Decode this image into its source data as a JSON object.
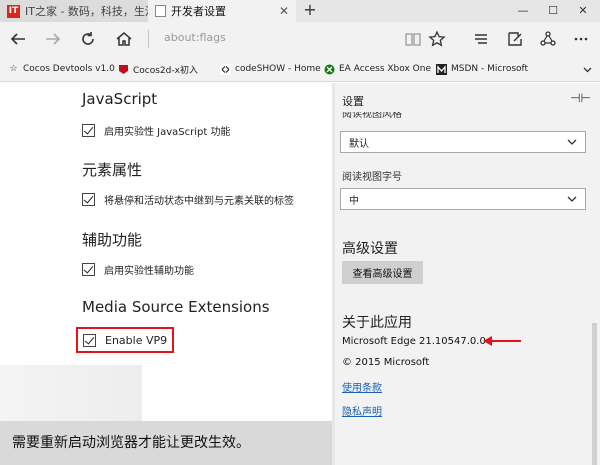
{
  "tabs": [
    {
      "title": "IT之家 - 数码，科技，生活",
      "favicon": "ithome-icon"
    },
    {
      "title": "开发者设置",
      "favicon": "page-icon"
    }
  ],
  "address": {
    "url": "about:flags"
  },
  "favorites": [
    {
      "label": "Cocos Devtools v1.0"
    },
    {
      "label": "Cocos2d-x初入"
    },
    {
      "label": "codeSHOW - Home"
    },
    {
      "label": "EA Access  Xbox One"
    },
    {
      "label": "MSDN - Microsoft"
    }
  ],
  "flags": {
    "sections": [
      {
        "title": "JavaScript",
        "option": "启用实验性 JavaScript 功能",
        "checked": true
      },
      {
        "title": "元素属性",
        "option": "将悬停和活动状态中继到与元素关联的标签",
        "checked": true
      },
      {
        "title": "辅助功能",
        "option": "启用实验性辅助功能",
        "checked": true
      },
      {
        "title": "Media Source Extensions",
        "option": "Enable VP9",
        "checked": true
      }
    ],
    "restart_message": "需要重新启动浏览器才能让更改生效。"
  },
  "settings": {
    "title": "设置",
    "cut_label": "阅读视图风格",
    "reading_style_value": "默认",
    "font_size_label": "阅读视图字号",
    "font_size_value": "中",
    "advanced_title": "高级设置",
    "advanced_button": "查看高级设置",
    "about_title": "关于此应用",
    "version": "Microsoft Edge 21.10547.0.0",
    "copyright": "© 2015 Microsoft",
    "terms_link": "使用条款",
    "privacy_link": "隐私声明"
  },
  "colors": {
    "accent_red": "#e0151e",
    "link_blue": "#1a5fb4"
  }
}
